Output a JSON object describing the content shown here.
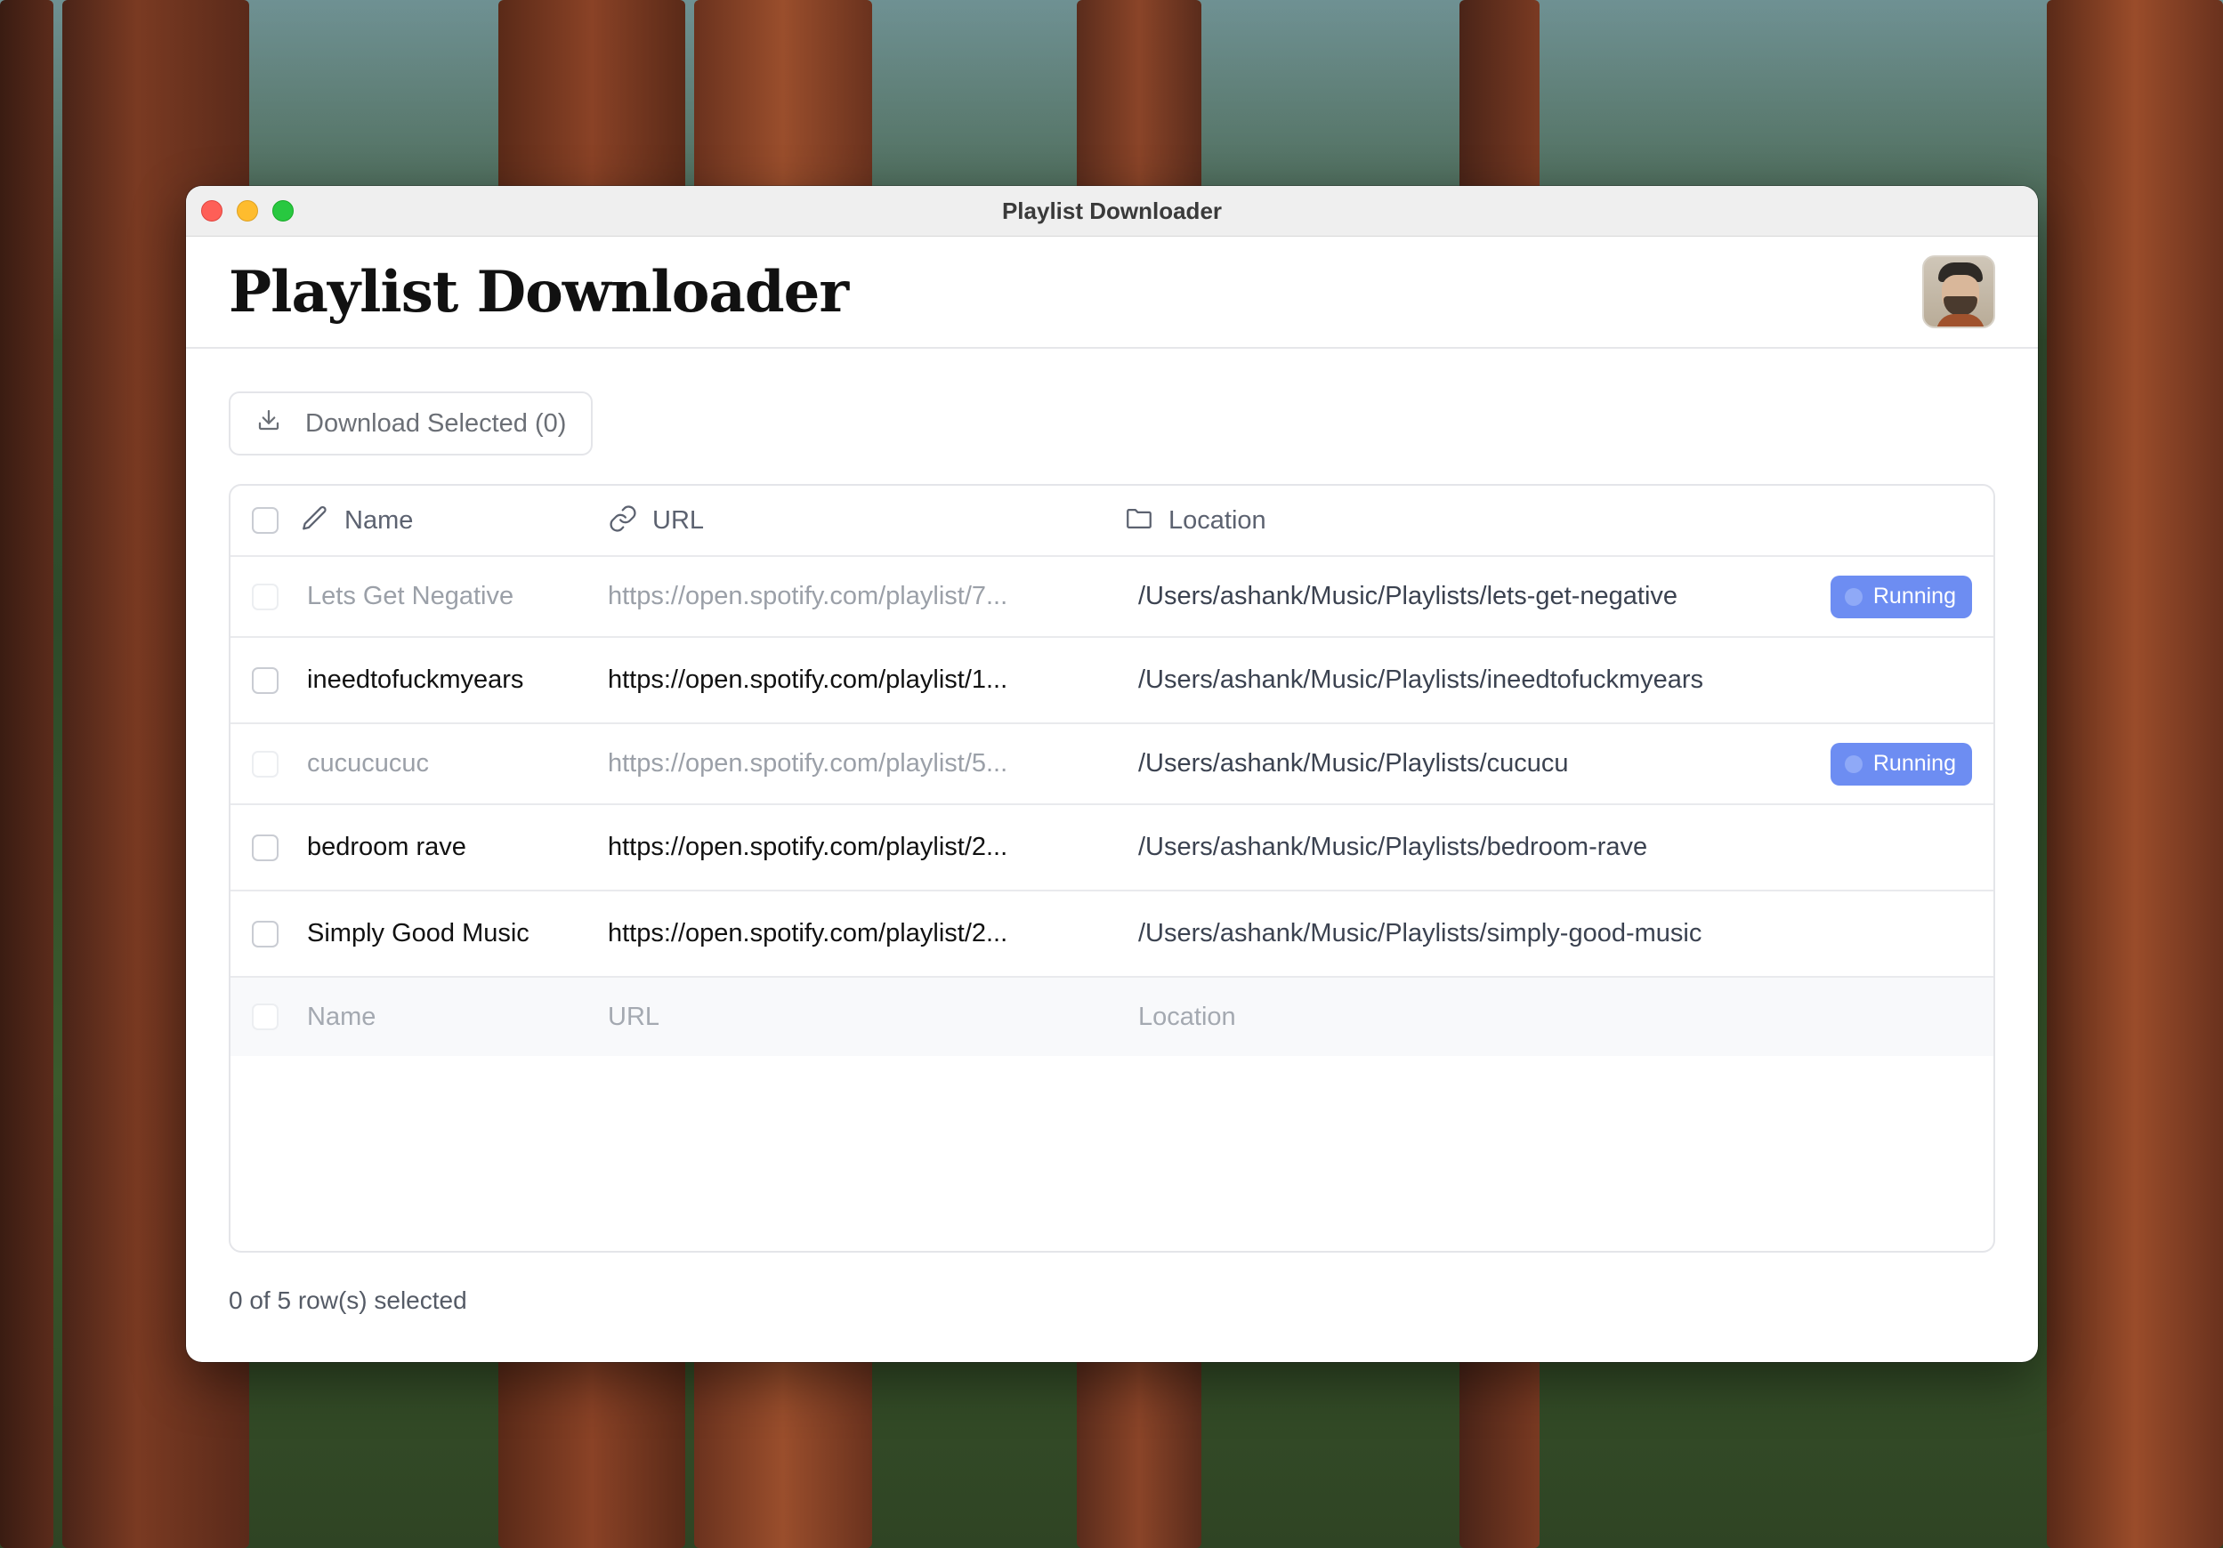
{
  "window": {
    "title": "Playlist Downloader"
  },
  "header": {
    "app_title": "Playlist Downloader"
  },
  "toolbar": {
    "download_label": "Download Selected (0)"
  },
  "table": {
    "columns": {
      "name": "Name",
      "url": "URL",
      "location": "Location"
    },
    "rows": [
      {
        "name": "Lets Get Negative",
        "url": "https://open.spotify.com/playlist/7...",
        "location": "/Users/ashank/Music/Playlists/lets-get-negative",
        "status": "Running"
      },
      {
        "name": "ineedtofuckmyears",
        "url": "https://open.spotify.com/playlist/1...",
        "location": "/Users/ashank/Music/Playlists/ineedtofuckmyears",
        "status": ""
      },
      {
        "name": "cucucucuc",
        "url": "https://open.spotify.com/playlist/5...",
        "location": "/Users/ashank/Music/Playlists/cucucu",
        "status": "Running"
      },
      {
        "name": "bedroom rave",
        "url": "https://open.spotify.com/playlist/2...",
        "location": "/Users/ashank/Music/Playlists/bedroom-rave",
        "status": ""
      },
      {
        "name": "Simply Good Music",
        "url": "https://open.spotify.com/playlist/2...",
        "location": "/Users/ashank/Music/Playlists/simply-good-music",
        "status": ""
      }
    ],
    "new_row": {
      "name_placeholder": "Name",
      "url_placeholder": "URL",
      "location_placeholder": "Location"
    }
  },
  "footer": {
    "selection_text": "0 of 5 row(s) selected"
  },
  "colors": {
    "badge": "#6d8df2",
    "close": "#fe5f57",
    "minimize": "#febc2e",
    "zoom": "#28c840"
  }
}
